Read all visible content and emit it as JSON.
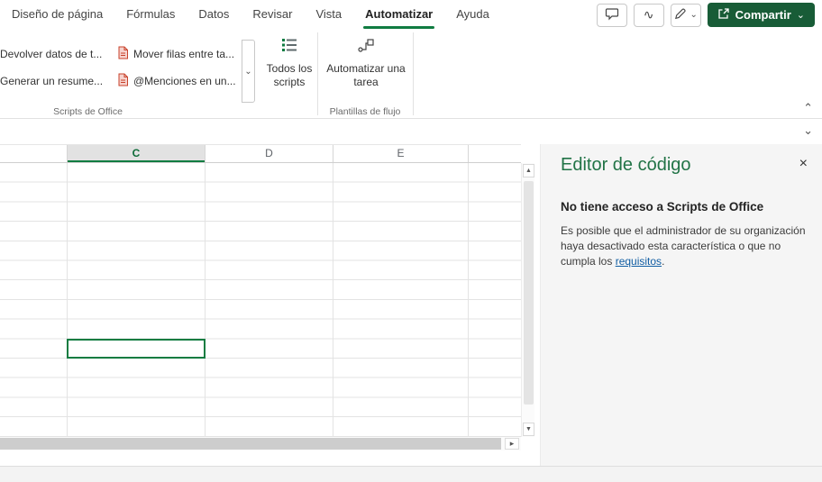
{
  "tabs": {
    "items": [
      {
        "label": "Diseño de página",
        "active": false
      },
      {
        "label": "Fórmulas",
        "active": false
      },
      {
        "label": "Datos",
        "active": false
      },
      {
        "label": "Revisar",
        "active": false
      },
      {
        "label": "Vista",
        "active": false
      },
      {
        "label": "Automatizar",
        "active": true
      },
      {
        "label": "Ayuda",
        "active": false
      }
    ]
  },
  "topbar": {
    "share_label": "Compartir"
  },
  "ribbon": {
    "gallery_items": [
      {
        "label": "Devolver datos de t..."
      },
      {
        "label": "Mover filas entre ta..."
      },
      {
        "label": "Generar un resume..."
      },
      {
        "label": "@Menciones en un..."
      }
    ],
    "all_scripts_label": "Todos los scripts",
    "automate_task_label": "Automatizar una tarea",
    "group_scripts_label": "Scripts de Office",
    "group_flow_label": "Plantillas de flujo"
  },
  "grid": {
    "columns": [
      "C",
      "D",
      "E"
    ],
    "selected_column": "C"
  },
  "panel": {
    "title": "Editor de código",
    "heading": "No tiene acceso a Scripts de Office",
    "body_before": "Es posible que el administrador de su organización haya desactivado esta característica o que no cumpla los ",
    "link_text": "requisitos",
    "body_after": "."
  },
  "icons": {
    "chevron_down": "⌄",
    "chevron_up": "⌃",
    "close": "×",
    "activity": "∿",
    "scroll_up": "▲",
    "scroll_down": "▼",
    "scroll_right": "▸"
  },
  "colors": {
    "accent_green": "#107C41",
    "share_button_green": "#185C37",
    "title_green": "#217346",
    "link_blue": "#115EA3"
  }
}
